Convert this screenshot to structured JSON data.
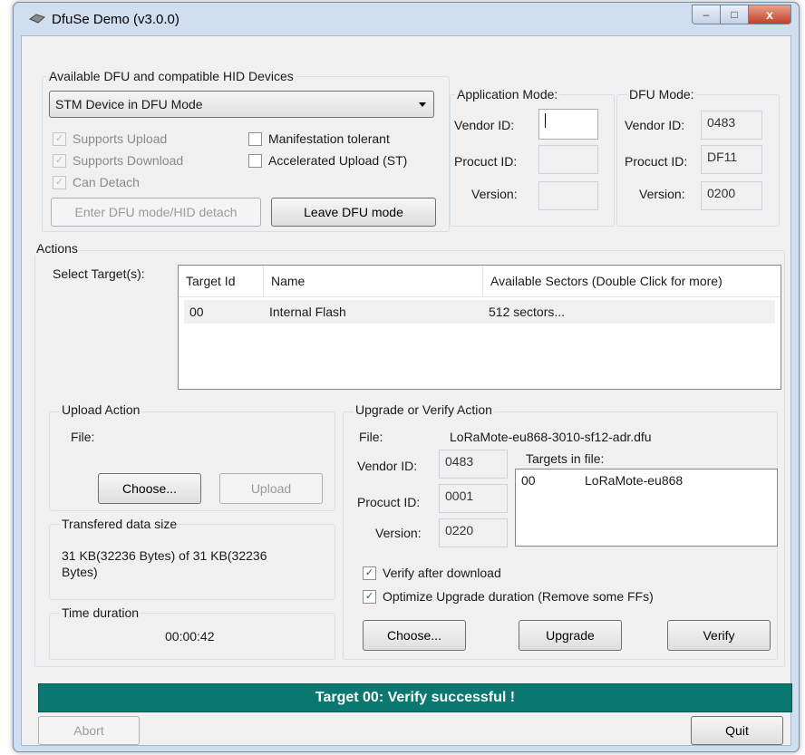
{
  "window": {
    "title": "DfuSe Demo (v3.0.0)",
    "controls": {
      "minimize": "–",
      "maximize": "□",
      "close": "x"
    }
  },
  "devices": {
    "group_label": "Available DFU and compatible HID Devices",
    "selected_device": "STM Device in DFU Mode",
    "checkboxes": {
      "supports_upload": {
        "label": "Supports Upload",
        "checked": true
      },
      "supports_download": {
        "label": "Supports Download",
        "checked": true
      },
      "can_detach": {
        "label": "Can Detach",
        "checked": true
      },
      "manifestation_tolerant": {
        "label": "Manifestation tolerant",
        "checked": false
      },
      "accelerated_upload": {
        "label": "Accelerated Upload (ST)",
        "checked": false
      }
    },
    "enter_dfu_label": "Enter DFU mode/HID detach",
    "leave_dfu_label": "Leave DFU mode"
  },
  "app_mode": {
    "group_label": "Application Mode:",
    "vendor_label": "Vendor ID:",
    "product_label": "Procuct ID:",
    "version_label": "Version:",
    "vendor_value": "",
    "product_value": "",
    "version_value": ""
  },
  "dfu_mode": {
    "group_label": "DFU Mode:",
    "vendor_label": "Vendor ID:",
    "product_label": "Procuct ID:",
    "version_label": "Version:",
    "vendor_value": "0483",
    "product_value": "DF11",
    "version_value": "0200"
  },
  "actions": {
    "group_label": "Actions",
    "select_targets_label": "Select Target(s):",
    "columns": [
      "Target Id",
      "Name",
      "Available Sectors (Double Click for more)"
    ],
    "rows": [
      {
        "id": "00",
        "name": "Internal Flash",
        "sectors": "512 sectors..."
      }
    ]
  },
  "upload": {
    "group_label": "Upload Action",
    "file_label": "File:",
    "choose_label": "Choose...",
    "upload_label": "Upload"
  },
  "transfer": {
    "group_label": "Transfered data size",
    "line1": "31 KB(32236 Bytes) of 31 KB(32236",
    "line2": "Bytes)"
  },
  "time": {
    "group_label": "Time duration",
    "value": "00:00:42"
  },
  "upgrade": {
    "group_label": "Upgrade or Verify Action",
    "file_label": "File:",
    "file_name": "LoRaMote-eu868-3010-sf12-adr.dfu",
    "vendor_label": "Vendor ID:",
    "product_label": "Procuct ID:",
    "version_label": "Version:",
    "vendor_value": "0483",
    "product_value": "0001",
    "version_value": "0220",
    "targets_label": "Targets in file:",
    "targets": [
      {
        "id": "00",
        "name": "LoRaMote-eu868"
      }
    ],
    "verify_after": {
      "label": "Verify after download",
      "checked": true
    },
    "optimize": {
      "label": "Optimize Upgrade duration (Remove some FFs)",
      "checked": true
    },
    "choose_label": "Choose...",
    "upgrade_label": "Upgrade",
    "verify_label": "Verify"
  },
  "status": {
    "text": "Target 00: Verify successful !",
    "color": "#0a7770"
  },
  "footer": {
    "abort_label": "Abort",
    "quit_label": "Quit"
  }
}
